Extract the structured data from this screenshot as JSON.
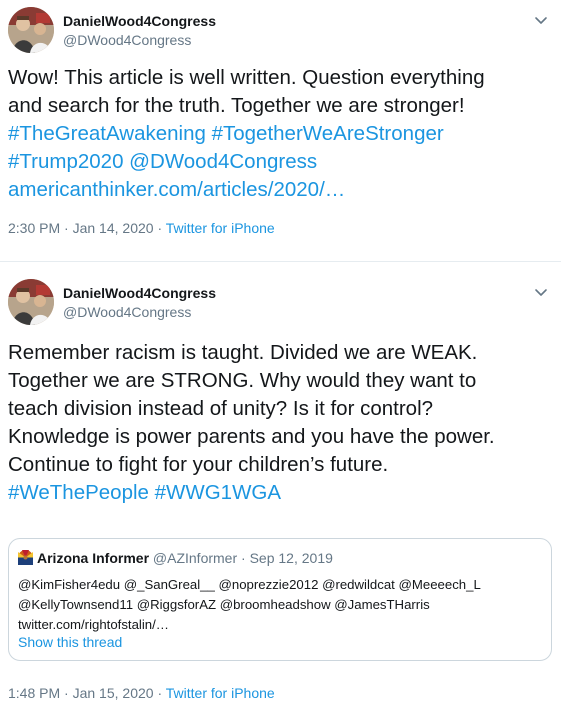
{
  "tweets": [
    {
      "author": {
        "name": "DanielWood4Congress",
        "handle": "@DWood4Congress"
      },
      "text_lines": [
        "Wow! This article is well written. Question everything",
        "and search for the truth. Together we are stronger!"
      ],
      "link_lines": [
        "#TheGreatAwakening #TogetherWeAreStronger",
        "#Trump2020 @DWood4Congress",
        "americanthinker.com/articles/2020/…"
      ],
      "meta": {
        "time": "2:30 PM",
        "sep1": " · ",
        "date": "Jan 14, 2020",
        "sep2": " · ",
        "source": "Twitter for iPhone"
      }
    },
    {
      "author": {
        "name": "DanielWood4Congress",
        "handle": "@DWood4Congress"
      },
      "text_lines": [
        "Remember racism is taught. Divided we are WEAK.",
        "Together we are STRONG. Why would they want to",
        "teach division instead of unity? Is it for control?",
        "Knowledge is power parents and you have the power.",
        "Continue to fight for your children’s future."
      ],
      "link_lines": [
        "#WeThePeople #WWG1WGA"
      ],
      "quote": {
        "name": "Arizona Informer",
        "handle": "@AZInformer",
        "dot": " · ",
        "date": "Sep 12, 2019",
        "body_lines": [
          "@KimFisher4edu @_SanGreal__ @noprezzie2012 @redwildcat @Meeeech_L",
          "@KellyTownsend11 @RiggsforAZ @broomheadshow @JamesTHarris",
          "twitter.com/rightofstalin/…"
        ],
        "show_thread": "Show this thread",
        "icon": "arizona-flag-icon"
      },
      "meta": {
        "time": "1:48 PM",
        "sep1": " · ",
        "date": "Jan 15, 2020",
        "sep2": " · ",
        "source": "Twitter for iPhone"
      }
    }
  ],
  "colors": {
    "link": "#1b95e0",
    "muted": "#657786",
    "text": "#14171a",
    "border": "#ccd6dd"
  },
  "icons": {
    "caret": "chevron-down-icon",
    "avatar": "profile-photo"
  }
}
